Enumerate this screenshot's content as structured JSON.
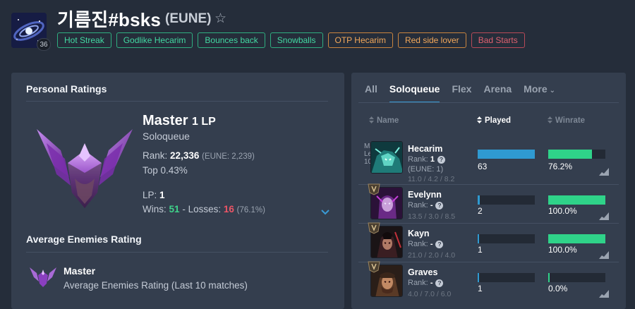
{
  "profile": {
    "name": "기름진#bsks",
    "region": "(EUNE)",
    "level": "36",
    "tags": [
      {
        "label": "Hot Streak",
        "color": "green"
      },
      {
        "label": "Godlike Hecarim",
        "color": "green"
      },
      {
        "label": "Bounces back",
        "color": "green"
      },
      {
        "label": "Snowballs",
        "color": "green"
      },
      {
        "label": "OTP Hecarim",
        "color": "orange"
      },
      {
        "label": "Red side lover",
        "color": "orange"
      },
      {
        "label": "Bad Starts",
        "color": "red"
      }
    ]
  },
  "personal_ratings": {
    "title": "Personal Ratings",
    "tier": "Master",
    "lp_suffix": "1 LP",
    "queue": "Soloqueue",
    "rank_label": "Rank:",
    "rank_value": "22,336",
    "rank_region": "(EUNE: 2,239)",
    "top_percent": "Top 0.43%",
    "lp_label": "LP:",
    "lp_value": "1",
    "wins_label": "Wins:",
    "wins": "51",
    "separator": "-",
    "losses_label": "Losses:",
    "losses": "16",
    "winrate": "(76.1%)"
  },
  "average_enemies": {
    "title": "Average Enemies Rating",
    "tier": "Master",
    "description": "Average Enemies Rating (Last 10 matches)"
  },
  "champion_tabs": [
    "All",
    "Soloqueue",
    "Flex",
    "Arena",
    "More"
  ],
  "active_tab": "Soloqueue",
  "columns": {
    "name": "Name",
    "played": "Played",
    "winrate": "Winrate"
  },
  "champions": [
    {
      "name": "Hecarim",
      "rank_label": "Rank:",
      "rank": "1",
      "rank_extra": "(EUNE: 1)",
      "kda": "11.0 / 4.2 / 8.2",
      "played": "63",
      "played_fraction": 1.0,
      "winrate": "76.2%",
      "winrate_fraction": 0.762,
      "broken_alt": "Mas Leve 10"
    },
    {
      "name": "Evelynn",
      "rank_label": "Rank:",
      "rank": "-",
      "kda": "13.5 / 3.0 / 8.5",
      "played": "2",
      "played_fraction": 0.032,
      "winrate": "100.0%",
      "winrate_fraction": 1.0
    },
    {
      "name": "Kayn",
      "rank_label": "Rank:",
      "rank": "-",
      "kda": "21.0 / 2.0 / 4.0",
      "played": "1",
      "played_fraction": 0.016,
      "winrate": "100.0%",
      "winrate_fraction": 1.0
    },
    {
      "name": "Graves",
      "rank_label": "Rank:",
      "rank": "-",
      "kda": "4.0 / 7.0 / 6.0",
      "played": "1",
      "played_fraction": 0.016,
      "winrate": "0.0%",
      "winrate_fraction": 0.0
    }
  ],
  "colors": {
    "accent": "#3a9bd6",
    "win": "#3fd38a",
    "loss": "#ec5566",
    "played_bar": "#2f9ad1",
    "winrate_bar": "#2fd389"
  }
}
